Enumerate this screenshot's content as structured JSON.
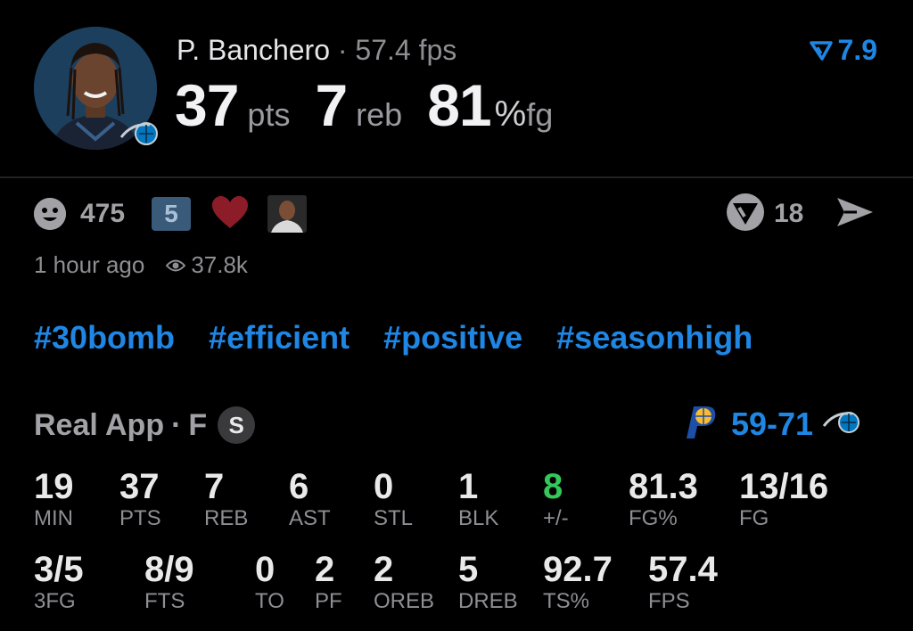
{
  "header": {
    "player_name": "P. Banchero",
    "separator": "·",
    "fps": "57.4 fps",
    "pts_value": "37",
    "pts_unit": "pts",
    "reb_value": "7",
    "reb_unit": "reb",
    "fg_value": "81",
    "fg_pct_sign": "%",
    "fg_unit": "fg",
    "rating": "7.9",
    "accent_color": "#1f86e4"
  },
  "reactions": {
    "smile_count": "475",
    "streak_badge": "5",
    "comment_count": "18",
    "icons": [
      "smile-icon",
      "heart-icon",
      "real-logo-icon",
      "send-icon"
    ]
  },
  "meta": {
    "time_ago": "1 hour ago",
    "views": "37.8k"
  },
  "tags": [
    "#30bomb",
    "#efficient",
    "#positive",
    "#seasonhigh"
  ],
  "source": {
    "app": "Real App",
    "separator": "·",
    "position": "F",
    "badge": "S",
    "score": "59-71"
  },
  "stats": [
    {
      "value": "19",
      "label": "MIN"
    },
    {
      "value": "37",
      "label": "PTS"
    },
    {
      "value": "7",
      "label": "REB"
    },
    {
      "value": "6",
      "label": "AST"
    },
    {
      "value": "0",
      "label": "STL"
    },
    {
      "value": "1",
      "label": "BLK"
    },
    {
      "value": "8",
      "label": "+/-"
    },
    {
      "value": "81.3",
      "label": "FG%"
    },
    {
      "value": "13/16",
      "label": "FG"
    },
    {
      "value": "3/5",
      "label": "3FG"
    },
    {
      "value": "8/9",
      "label": "FTS"
    },
    {
      "value": "0",
      "label": "TO"
    },
    {
      "value": "2",
      "label": "PF"
    },
    {
      "value": "2",
      "label": "OREB"
    },
    {
      "value": "5",
      "label": "DREB"
    },
    {
      "value": "92.7",
      "label": "TS%"
    },
    {
      "value": "57.4",
      "label": "FPS"
    }
  ],
  "colors": {
    "background": "#000000",
    "positive": "#34c759",
    "muted": "#8e8e93"
  }
}
